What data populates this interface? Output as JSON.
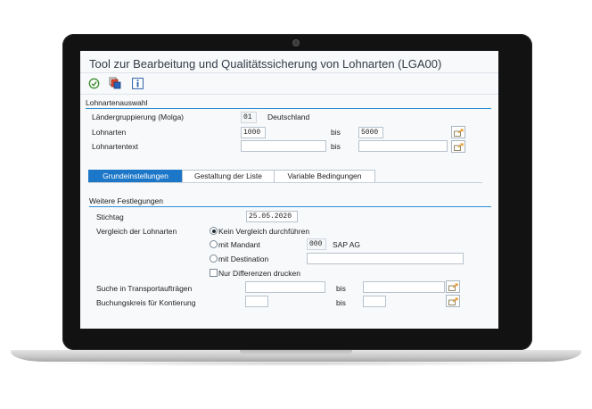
{
  "window": {
    "title": "Tool zur Bearbeitung und Qualitätssicherung von Lohnarten (LGA00)"
  },
  "toolbar": {
    "buttons": [
      "execute-icon",
      "variant-icon",
      "info-icon"
    ]
  },
  "selection": {
    "heading": "Lohnartenauswahl",
    "country_group_label": "Ländergruppierung (Molga)",
    "country_group_value": "01",
    "country_group_text": "Deutschland",
    "wage_types_label": "Lohnarten",
    "wage_types_from": "1000",
    "wage_types_to": "5000",
    "wage_type_text_label": "Lohnartentext",
    "wage_type_text_from": "",
    "wage_type_text_to": "",
    "bis_label": "bis"
  },
  "tabs": [
    {
      "label": "Grundeinstellungen",
      "active": true
    },
    {
      "label": "Gestaltung der Liste",
      "active": false
    },
    {
      "label": "Variable Bedingungen",
      "active": false
    }
  ],
  "settings": {
    "heading": "Weitere Festlegungen",
    "key_date_label": "Stichtag",
    "key_date_value": "25.05.2020",
    "compare_label": "Vergleich der Lohnarten",
    "option_none": "Kein Vergleich durchführen",
    "option_client": "mit Mandant",
    "client_value": "000",
    "client_text": "SAP AG",
    "option_destination": "mit Destination",
    "destination_value": "",
    "differences_only": "Nur Differenzen drucken",
    "transport_label": "Suche in Transportaufträgen",
    "transport_from": "",
    "transport_to": "",
    "company_code_label": "Buchungskreis für Kontierung",
    "company_code_from": "",
    "company_code_to": "",
    "bis_label": "bis"
  },
  "colors": {
    "accent": "#1d77c9",
    "section_rule": "#2d8fd4",
    "screen_bg": "#f7f9fb"
  }
}
